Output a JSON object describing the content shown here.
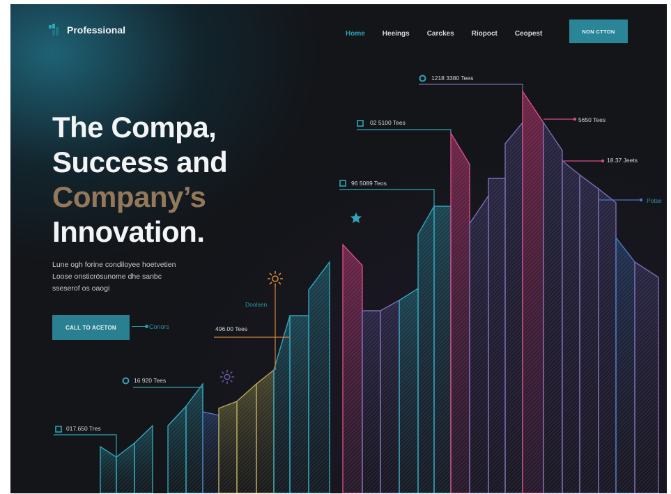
{
  "brand": {
    "name": "Professional"
  },
  "nav": {
    "items": [
      {
        "label": "Home",
        "active": true
      },
      {
        "label": "Heeings",
        "active": false
      },
      {
        "label": "Carckes",
        "active": false
      },
      {
        "label": "Riopoct",
        "active": false
      },
      {
        "label": "Ceopest",
        "active": false
      }
    ],
    "cta_label": "NON CTTON"
  },
  "hero": {
    "title_lines": [
      "The Compa,",
      "Success and",
      "Company’s",
      "Innovation."
    ],
    "subtitle_lines": [
      "Lune ogh forine condiloyee hoetvetien",
      "Loose onsticrösunome dhe sanbc",
      "sseserof os oaogi"
    ],
    "cta_label": "CALL TO ACETON",
    "cta_link_label": "Conors"
  },
  "annotations": [
    "017.650 Tres",
    "16 920 Tees",
    "496.00 Tees",
    "Doolsen",
    "96 5089 Teos",
    "02 5100 Tees",
    "1218 3380 Tees",
    "5650 Tees",
    "18.37 Jeets",
    "Potse"
  ],
  "colors": {
    "background": "#131519",
    "accent_teal": "#2a8596",
    "accent_gold": "#94785a",
    "accent_pink": "#d44d86",
    "accent_purple": "#7a6bb0"
  },
  "icons": [
    "logo-bars-icon",
    "sun-icon",
    "star-icon",
    "ring-icon",
    "square-icon"
  ]
}
